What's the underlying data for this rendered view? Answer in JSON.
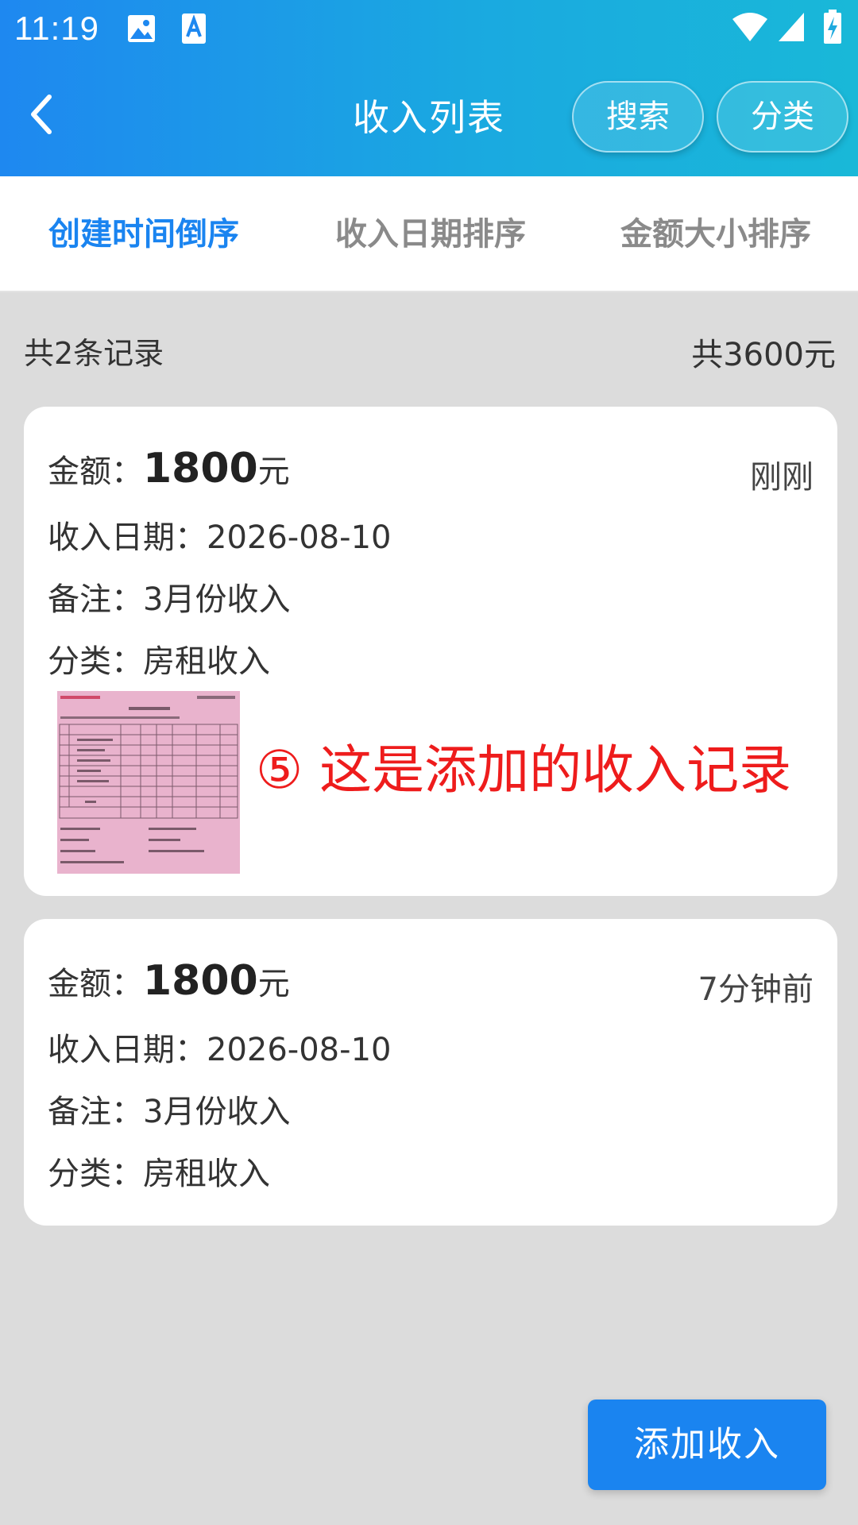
{
  "status_bar": {
    "time": "11:19"
  },
  "header": {
    "title": "收入列表",
    "search_label": "搜索",
    "category_label": "分类"
  },
  "tabs": [
    {
      "label": "创建时间倒序",
      "active": true
    },
    {
      "label": "收入日期排序",
      "active": false
    },
    {
      "label": "金额大小排序",
      "active": false
    }
  ],
  "summary": {
    "count_text": "共2条记录",
    "total_text": "共3600元"
  },
  "records": [
    {
      "amount_label": "金额：",
      "amount_value": "1800",
      "amount_unit": "元",
      "time_ago": "刚刚",
      "date_label": "收入日期：",
      "date_value": "2026-08-10",
      "note_label": "备注：",
      "note_value": "3月份收入",
      "category_label": "分类：",
      "category_value": "房租收入",
      "annotation": "⑤ 这是添加的收入记录"
    },
    {
      "amount_label": "金额：",
      "amount_value": "1800",
      "amount_unit": "元",
      "time_ago": "7分钟前",
      "date_label": "收入日期：",
      "date_value": "2026-08-10",
      "note_label": "备注：",
      "note_value": "3月份收入",
      "category_label": "分类：",
      "category_value": "房租收入"
    }
  ],
  "add_button_label": "添加收入",
  "colors": {
    "accent": "#1a84f0",
    "header_start": "#1e88f0",
    "header_end": "#19b8d8",
    "annotation": "#ee1c1c",
    "background": "#dcdcdc"
  },
  "icons": {
    "back": "chevron-left-icon",
    "gallery": "image-icon",
    "font": "font-a-icon",
    "wifi": "wifi-icon",
    "signal": "signal-icon",
    "battery": "battery-charging-icon"
  }
}
